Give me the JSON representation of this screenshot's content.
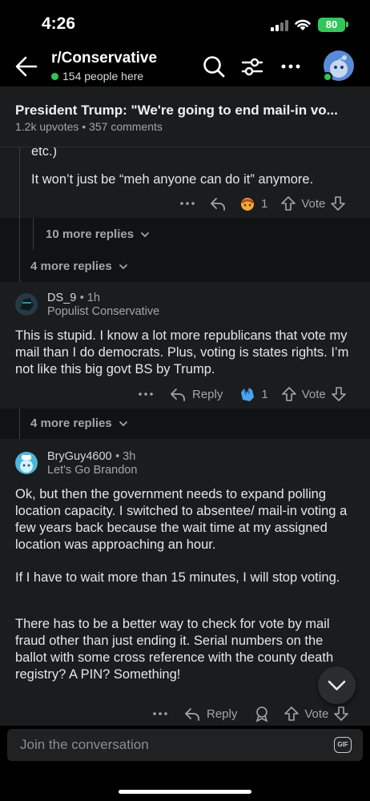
{
  "status": {
    "time": "4:26",
    "battery": "80"
  },
  "header": {
    "subreddit": "r/Conservative",
    "online": "154 people here"
  },
  "post": {
    "title": "President Trump: \"We're going to end mail-in vo...",
    "meta": "1.2k upvotes • 357 comments"
  },
  "comments": {
    "c0": {
      "tail": "etc.)",
      "text": "It won’t just be “meh anyone can do it” anymore.",
      "award_count": "1",
      "vote": "Vote"
    },
    "more1": "10 more replies",
    "more2": "4 more replies",
    "c1": {
      "user": "DS_9",
      "time": "1h",
      "flair": "Populist Conservative",
      "text": "This is stupid. I know a lot more republicans that vote my mail than I do democrats. Plus, voting is states rights. I’m not like this big govt BS by Trump.",
      "reply": "Reply",
      "award_count": "1",
      "vote": "Vote"
    },
    "more3": "4 more replies",
    "c2": {
      "user": "BryGuy4600",
      "time": "3h",
      "flair": "Let's Go Brandon",
      "p1": "Ok, but then the government needs to expand polling location capacity.  I switched to absentee/ mail-in voting a few years back because the wait time at my assigned location was approaching an hour.",
      "p2": "If I have to wait more than 15 minutes, I will stop voting.",
      "p3": "There has to be a better way to check for vote by mail fraud other than just ending it. Serial numbers on the ballot with some cross reference with the county death registry? A PIN? Something!",
      "reply": "Reply",
      "vote": "Vote"
    }
  },
  "composer": {
    "placeholder": "Join the conversation",
    "gif": "GIF"
  },
  "colors": {
    "background": "#101214",
    "card": "#1a1c1e",
    "online": "#2dc653",
    "battery": "#33c759"
  }
}
